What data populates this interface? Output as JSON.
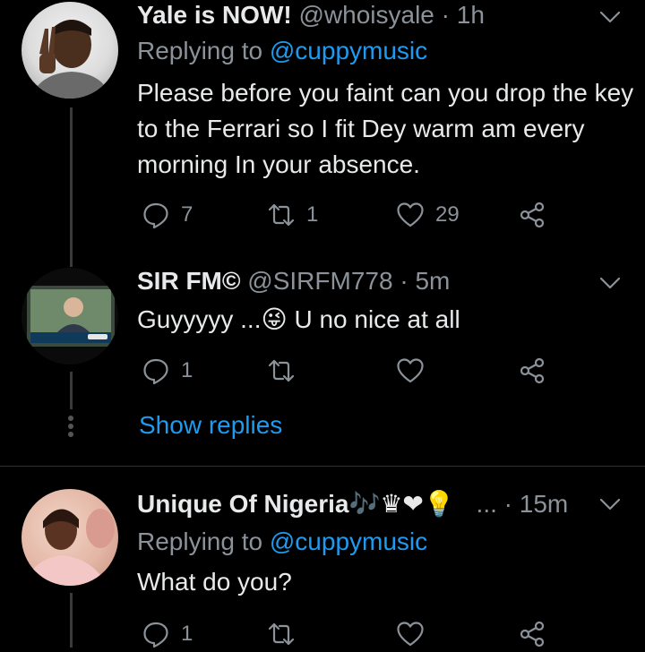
{
  "tweets": [
    {
      "name": "Yale is NOW!",
      "handle": "@whoisyale",
      "time": "1h",
      "replying_prefix": "Replying to",
      "replying_to": "@cuppymusic",
      "text": "Please before you faint can you drop the key to the Ferrari so I fit Dey warm am every morning In your absence.",
      "replies": "7",
      "retweets": "1",
      "likes": "29"
    },
    {
      "name": "SIR FM©",
      "handle": "@SIRFM778",
      "time": "5m",
      "text_before": "Guyyyyy ...",
      "emoji": "😜",
      "text_after": " U no nice at all",
      "replies": "1",
      "retweets": "",
      "likes": "",
      "show_replies": "Show replies"
    },
    {
      "name": "Unique Of Nigeria",
      "name_emojis": "🎶♛❤💡",
      "ellipsis": "...",
      "time": "15m",
      "replying_prefix": "Replying to",
      "replying_to": "@cuppymusic",
      "text": "What do you?",
      "replies": "1",
      "retweets": "",
      "likes": ""
    }
  ],
  "separator": "·",
  "colors": {
    "background": "#000000",
    "text": "#e7e9ea",
    "secondary": "#8b9299",
    "accent": "#1d9bf0"
  }
}
